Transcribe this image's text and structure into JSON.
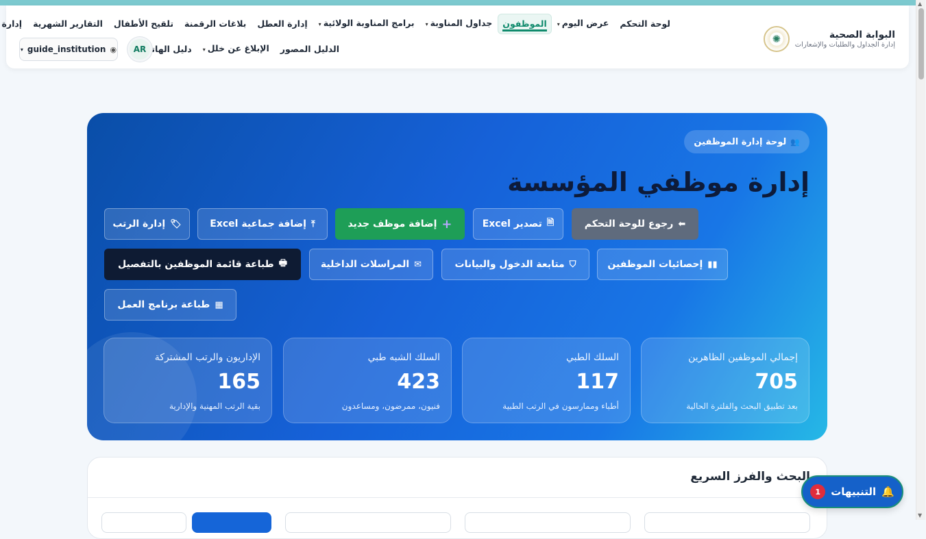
{
  "brand": {
    "title": "البوابة الصحية",
    "subtitle": "إدارة الجداول والطلبات والإشعارات"
  },
  "nav": {
    "row1": [
      {
        "label": "لوحة التحكم",
        "dropdown": false,
        "active": false
      },
      {
        "label": "عرض اليوم",
        "dropdown": true,
        "active": false
      },
      {
        "label": "الموظفون",
        "dropdown": false,
        "active": true
      },
      {
        "label": "جداول المناوبة",
        "dropdown": true,
        "active": false
      },
      {
        "label": "برامج المناوبة الولائية",
        "dropdown": true,
        "active": false
      },
      {
        "label": "إدارة العطل",
        "dropdown": false,
        "active": false
      },
      {
        "label": "بلاغات الرقمنة",
        "dropdown": false,
        "active": false
      },
      {
        "label": "تلقيح الأطفال",
        "dropdown": false,
        "active": false
      },
      {
        "label": "التقارير الشهرية",
        "dropdown": false,
        "active": false
      },
      {
        "label": "إدارة التبديلات",
        "dropdown": false,
        "active": false
      }
    ],
    "row2": [
      {
        "label": "الدليل المصور",
        "dropdown": false,
        "active": false
      },
      {
        "label": "الإبلاغ عن خلل",
        "dropdown": true,
        "active": false
      },
      {
        "label": "دليل الهاتف",
        "dropdown": false,
        "active": false
      }
    ],
    "lang": "AR",
    "user": "guide_institution"
  },
  "hero": {
    "badge": "لوحة إدارة الموظفين",
    "title": "إدارة موظفي المؤسسة",
    "buttons": {
      "back": "رجوع للوحة التحكم",
      "export": "تصدير Excel",
      "add": "إضافة موظف جديد",
      "bulk": "إضافة جماعية Excel",
      "grades": "إدارة الرتب",
      "stats": "إحصائيات الموظفين",
      "tracking": "متابعة الدخول والبيانات",
      "mail": "المراسلات الداخلية",
      "print_list": "طباعة قائمة الموظفين بالتفصيل",
      "print_program": "طباعة برنامج العمل"
    },
    "stats": [
      {
        "title": "إجمالي الموظفين الظاهرين",
        "value": "705",
        "sub": "بعد تطبيق البحث والفلترة الحالية"
      },
      {
        "title": "السلك الطبي",
        "value": "117",
        "sub": "أطباء وممارسون في الرتب الطبية"
      },
      {
        "title": "السلك الشبه طبي",
        "value": "423",
        "sub": "فنيون، ممرضون، ومساعدون"
      },
      {
        "title": "الإداريون والرتب المشتركة",
        "value": "165",
        "sub": "بقية الرتب المهنية والإدارية"
      }
    ]
  },
  "search": {
    "title": "البحث والفرز السريع"
  },
  "alerts": {
    "label": "التنبيهات",
    "count": "1"
  },
  "colors": {
    "accent": "#0f8a6c",
    "hero": "#1661d8",
    "add_button": "#1e9e57",
    "alert_count": "#e02d3c"
  }
}
